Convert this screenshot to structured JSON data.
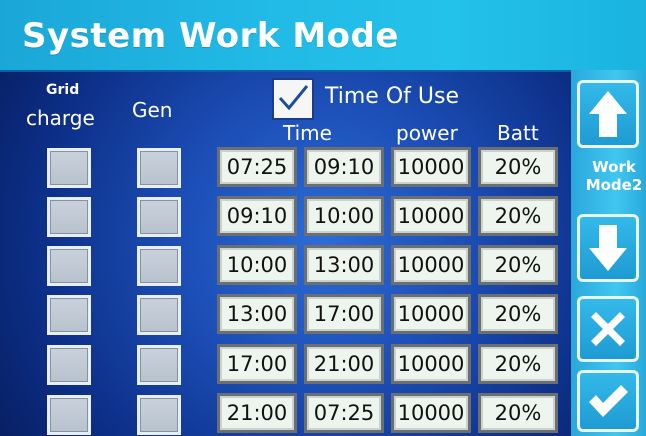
{
  "title": "System Work Mode",
  "headers": {
    "grid": "Grid",
    "charge": "charge",
    "gen": "Gen",
    "time": "Time",
    "power": "power",
    "batt": "Batt"
  },
  "time_of_use": {
    "label": "Time Of Use",
    "checked": true
  },
  "side_panel": {
    "work_mode_line1": "Work",
    "work_mode_line2": "Mode2",
    "buttons": [
      "arrow-up-icon",
      "arrow-down-icon",
      "close-icon",
      "check-icon"
    ]
  },
  "rows": [
    {
      "start": "07:25",
      "end": "09:10",
      "power": "10000",
      "batt": "20%"
    },
    {
      "start": "09:10",
      "end": "10:00",
      "power": "10000",
      "batt": "20%"
    },
    {
      "start": "10:00",
      "end": "13:00",
      "power": "10000",
      "batt": "20%"
    },
    {
      "start": "13:00",
      "end": "17:00",
      "power": "10000",
      "batt": "20%"
    },
    {
      "start": "17:00",
      "end": "21:00",
      "power": "10000",
      "batt": "20%"
    },
    {
      "start": "21:00",
      "end": "07:25",
      "power": "10000",
      "batt": "20%"
    }
  ],
  "colors": {
    "title_bar": "#22b9e6",
    "background": "#1c4fb7",
    "side_panel": "#41c7ef",
    "checkmark": "#1a4f97"
  }
}
